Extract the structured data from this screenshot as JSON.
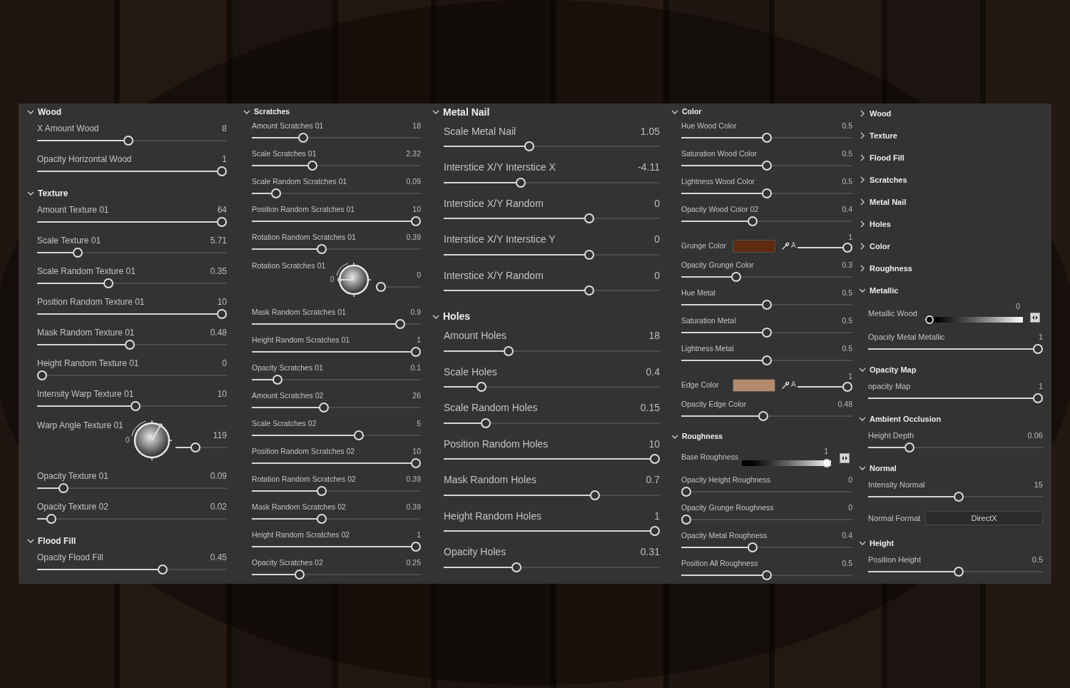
{
  "columns": [
    {
      "sections": [
        {
          "title": "Wood",
          "expanded": true,
          "controls": [
            {
              "kind": "slider",
              "label": "X Amount Wood",
              "value": "8",
              "level": 0.48
            },
            {
              "kind": "slider",
              "label": "Opacity Horizontal Wood",
              "value": "1",
              "level": 1
            }
          ]
        },
        {
          "title": "Texture",
          "expanded": true,
          "controls": [
            {
              "kind": "slider",
              "label": "Amount Texture 01",
              "value": "64",
              "level": 1
            },
            {
              "kind": "slider",
              "label": "Scale Texture 01",
              "value": "5.71",
              "level": 0.2
            },
            {
              "kind": "slider",
              "label": "Scale Random Texture 01",
              "value": "0.35",
              "level": 0.37
            },
            {
              "kind": "slider",
              "label": "Position Random Texture 01",
              "value": "10",
              "level": 1
            },
            {
              "kind": "slider",
              "label": "Mask Random Texture 01",
              "value": "0.48",
              "level": 0.49
            },
            {
              "kind": "slider",
              "label": "Height Random Texture 01",
              "value": "0",
              "level": 0
            },
            {
              "kind": "slider",
              "label": "Intensity Warp Texture 01",
              "value": "10",
              "level": 0.52
            },
            {
              "kind": "knob",
              "label": "Warp Angle Texture 01",
              "min_label": "0",
              "value": "119",
              "level": 0.36
            },
            {
              "kind": "slider",
              "label": "Opacity Texture 01",
              "value": "0.09",
              "level": 0.12
            },
            {
              "kind": "slider",
              "label": "Opacity Texture 02",
              "value": "0.02",
              "level": 0.05
            }
          ]
        },
        {
          "title": "Flood Fill",
          "expanded": true,
          "controls": [
            {
              "kind": "slider",
              "label": "Opacity Flood Fill",
              "value": "0.45",
              "level": 0.67
            }
          ]
        }
      ]
    },
    {
      "sections": [
        {
          "title": "Scratches",
          "expanded": true,
          "controls": [
            {
              "kind": "slider",
              "label": "Amount Scratches 01",
              "value": "18",
              "level": 0.29
            },
            {
              "kind": "slider",
              "label": "Scale Scratches 01",
              "value": "2.32",
              "level": 0.35
            },
            {
              "kind": "slider",
              "label": "Scale Random Scratches 01",
              "value": "0.09",
              "level": 0.12
            },
            {
              "kind": "slider",
              "label": "Position Random Scratches 01",
              "value": "10",
              "level": 1
            },
            {
              "kind": "slider",
              "label": "Rotation Random Scratches 01",
              "value": "0.39",
              "level": 0.41
            },
            {
              "kind": "knob",
              "label": "Rotation Scratches 01",
              "min_label": "0",
              "value": "0",
              "level": 0
            },
            {
              "kind": "slider",
              "label": "Mask Random Scratches 01",
              "value": "0.9",
              "level": 0.9
            },
            {
              "kind": "slider",
              "label": "Height Random Scratches 01",
              "value": "1",
              "level": 1
            },
            {
              "kind": "slider",
              "label": "Opacity Scratches 01",
              "value": "0.1",
              "level": 0.13
            },
            {
              "kind": "slider",
              "label": "Amount Scratches 02",
              "value": "26",
              "level": 0.42
            },
            {
              "kind": "slider",
              "label": "Scale Scratches 02",
              "value": "5",
              "level": 0.64
            },
            {
              "kind": "slider",
              "label": "Position Random Scratches 02",
              "value": "10",
              "level": 1
            },
            {
              "kind": "slider",
              "label": "Rotation Random Scratches 02",
              "value": "0.39",
              "level": 0.41
            },
            {
              "kind": "slider",
              "label": "Mask Random Scratches 02",
              "value": "0.39",
              "level": 0.41
            },
            {
              "kind": "slider",
              "label": "Height Random Scratches 02",
              "value": "1",
              "level": 1
            },
            {
              "kind": "slider",
              "label": "Opacity Scratches 02",
              "value": "0.25",
              "level": 0.27
            }
          ]
        }
      ]
    },
    {
      "sections": [
        {
          "title": "Metal Nail",
          "expanded": true,
          "controls": [
            {
              "kind": "slider",
              "label": "Scale Metal Nail",
              "value": "1.05",
              "level": 0.39
            },
            {
              "kind": "slider",
              "label": "Interstice X/Y Interstice X",
              "value": "-4.11",
              "level": 0.35
            },
            {
              "kind": "slider",
              "label": "Interstice X/Y Random",
              "value": "0",
              "level": 0.68
            },
            {
              "kind": "slider",
              "label": "Interstice X/Y Interstice Y",
              "value": "0",
              "level": 0.68
            },
            {
              "kind": "slider",
              "label": "Interstice X/Y Random",
              "value": "0",
              "level": 0.68
            }
          ]
        },
        {
          "title": "Holes",
          "expanded": true,
          "controls": [
            {
              "kind": "slider",
              "label": "Amount Holes",
              "value": "18",
              "level": 0.29
            },
            {
              "kind": "slider",
              "label": "Scale Holes",
              "value": "0.4",
              "level": 0.16
            },
            {
              "kind": "slider",
              "label": "Scale Random Holes",
              "value": "0.15",
              "level": 0.18
            },
            {
              "kind": "slider",
              "label": "Position Random Holes",
              "value": "10",
              "level": 1
            },
            {
              "kind": "slider",
              "label": "Mask Random Holes",
              "value": "0.7",
              "level": 0.71
            },
            {
              "kind": "slider",
              "label": "Height Random Holes",
              "value": "1",
              "level": 1
            },
            {
              "kind": "slider",
              "label": "Opacity Holes",
              "value": "0.31",
              "level": 0.33
            }
          ]
        }
      ]
    },
    {
      "sections": [
        {
          "title": "Color",
          "expanded": true,
          "controls": [
            {
              "kind": "slider",
              "label": "Hue Wood Color",
              "value": "0.5",
              "level": 0.5
            },
            {
              "kind": "slider",
              "label": "Saturation Wood Color",
              "value": "0.5",
              "level": 0.5
            },
            {
              "kind": "slider",
              "label": "Lightness Wood Color",
              "value": "0.5",
              "level": 0.5
            },
            {
              "kind": "slider",
              "label": "Opacity Wood Color 02",
              "value": "0.4",
              "level": 0.41
            },
            {
              "kind": "color",
              "label": "Grunge Color",
              "color": "#5e2a12",
              "alpha_label": "A",
              "value": "1",
              "level": 1
            },
            {
              "kind": "slider",
              "label": "Opacity Grunge Color",
              "value": "0.3",
              "level": 0.31
            },
            {
              "kind": "slider",
              "label": "Hue Metal",
              "value": "0.5",
              "level": 0.5
            },
            {
              "kind": "slider",
              "label": "Saturation Metal",
              "value": "0.5",
              "level": 0.5
            },
            {
              "kind": "slider",
              "label": "Lightness Metal",
              "value": "0.5",
              "level": 0.5
            },
            {
              "kind": "color",
              "label": "Edge Color",
              "color": "#b48a6c",
              "alpha_label": "A",
              "value": "1",
              "level": 1
            },
            {
              "kind": "slider",
              "label": "Opacity Edge Color",
              "value": "0.48",
              "level": 0.48
            }
          ]
        },
        {
          "title": "Roughness",
          "expanded": true,
          "controls": [
            {
              "kind": "gradient",
              "label": "Base Roughness",
              "value": "1",
              "level": 1
            },
            {
              "kind": "slider",
              "label": "Opacity Height Roughness",
              "value": "0",
              "level": 0
            },
            {
              "kind": "slider",
              "label": "Opacity Grunge Roughness",
              "value": "0",
              "level": 0
            },
            {
              "kind": "slider",
              "label": "Opacity Metal Roughness",
              "value": "0.4",
              "level": 0.41
            },
            {
              "kind": "slider",
              "label": "Position All Roughness",
              "value": "0.5",
              "level": 0.5
            }
          ]
        }
      ]
    },
    {
      "sections": [
        {
          "title": "Wood",
          "expanded": false
        },
        {
          "title": "Texture",
          "expanded": false
        },
        {
          "title": "Flood Fill",
          "expanded": false
        },
        {
          "title": "Scratches",
          "expanded": false
        },
        {
          "title": "Metal Nail",
          "expanded": false
        },
        {
          "title": "Holes",
          "expanded": false
        },
        {
          "title": "Color",
          "expanded": false
        },
        {
          "title": "Roughness",
          "expanded": false
        },
        {
          "title": "Metallic",
          "expanded": true,
          "controls": [
            {
              "kind": "gradient",
              "label": "Metallic Wood",
              "value": "0",
              "level": 0
            },
            {
              "kind": "slider",
              "label": "Opacity Metal Metallic",
              "value": "1",
              "level": 1
            }
          ]
        },
        {
          "title": "Opacity Map",
          "expanded": true,
          "controls": [
            {
              "kind": "slider",
              "label": "opacity Map",
              "value": "1",
              "level": 1
            }
          ]
        },
        {
          "title": "Ambient Occlusion",
          "expanded": true,
          "controls": [
            {
              "kind": "slider",
              "label": "Height Depth",
              "value": "0.06",
              "level": 0.22
            }
          ]
        },
        {
          "title": "Normal",
          "expanded": true,
          "controls": [
            {
              "kind": "slider",
              "label": "Intensity Normal",
              "value": "15",
              "level": 0.52
            },
            {
              "kind": "select",
              "label": "Normal Format",
              "value": "DirectX"
            }
          ]
        },
        {
          "title": "Height",
          "expanded": true,
          "controls": [
            {
              "kind": "slider",
              "label": "Position Height",
              "value": "0.5",
              "level": 0.52
            }
          ]
        }
      ]
    }
  ]
}
